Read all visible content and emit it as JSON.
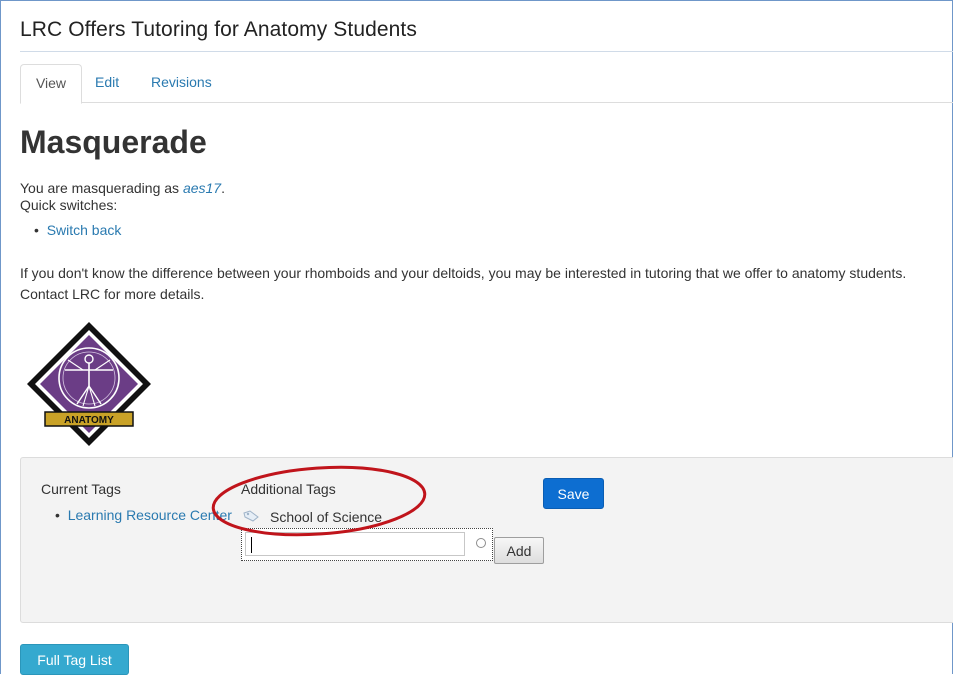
{
  "page": {
    "title": "LRC Offers Tutoring for Anatomy Students"
  },
  "tabs": [
    {
      "label": "View"
    },
    {
      "label": "Edit"
    },
    {
      "label": "Revisions"
    }
  ],
  "masquerade": {
    "heading": "Masquerade",
    "intro_prefix": "You are masquerading as ",
    "username": "aes17",
    "intro_suffix": ".",
    "quick_switches_label": "Quick switches:",
    "switch_back_label": "Switch back"
  },
  "article": {
    "line1": "If you don't know the difference between your rhomboids and your deltoids, you may be interested in tutoring that we offer to anatomy students.",
    "line2": "Contact LRC for more details.",
    "logo_text": "ANATOMY"
  },
  "tags": {
    "current_label": "Current Tags",
    "current_items": [
      "Learning Resource Center"
    ],
    "additional_label": "Additional Tags",
    "additional_items": [
      "School of Science"
    ],
    "input_value": "",
    "add_label": "Add",
    "save_label": "Save"
  },
  "full_tag_list_label": "Full Tag List",
  "colors": {
    "link": "#2a7ab0",
    "save_button": "#0d6ed1",
    "full_tag_button": "#35a9cf",
    "annotation": "#c0141b",
    "logo_purple": "#6b3d86",
    "logo_gold": "#c9a227"
  }
}
